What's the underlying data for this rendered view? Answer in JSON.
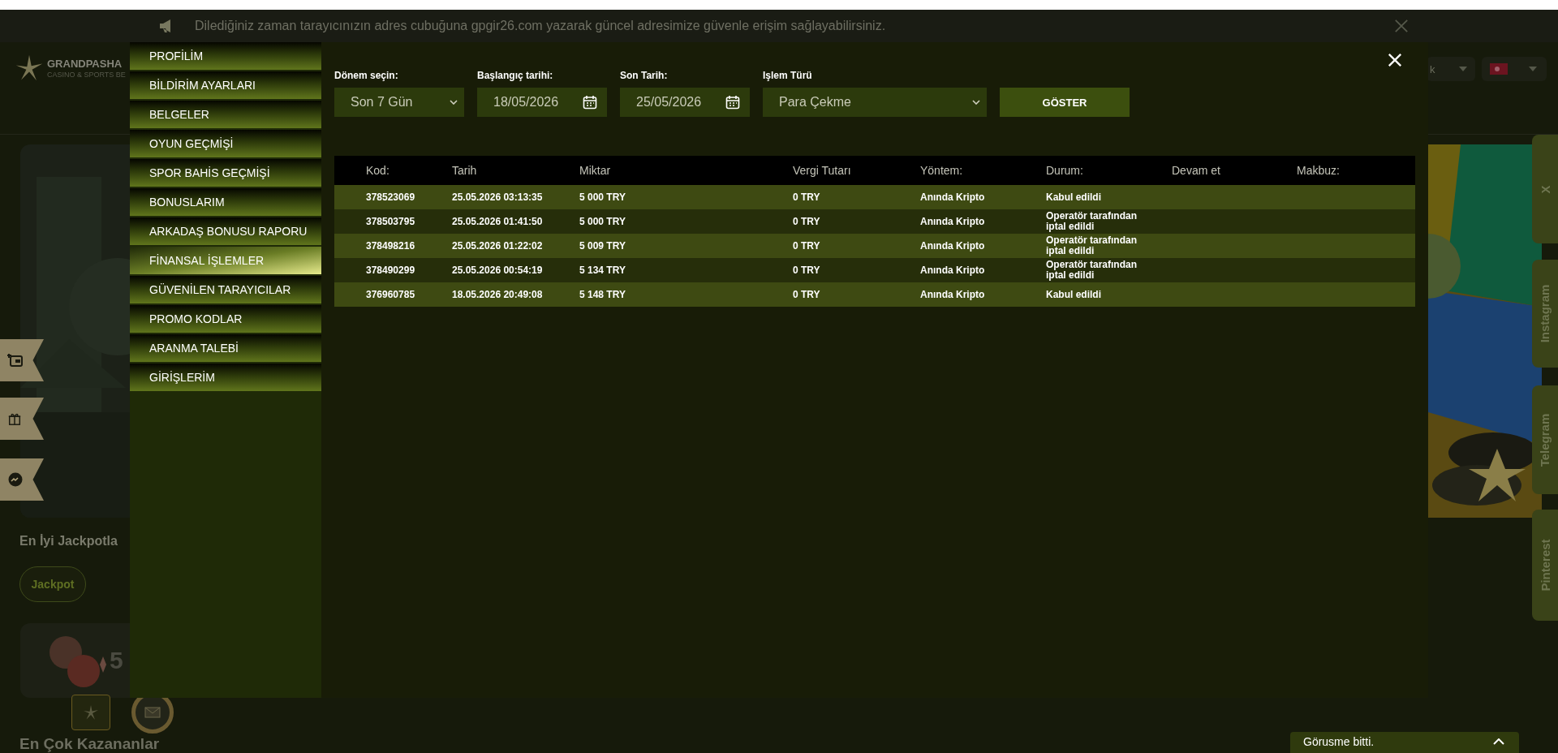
{
  "announcement": {
    "text": "Dilediğiniz zaman tarayıcınızın adres cubuğuna gpgir26.com yazarak güncel adresimize güvenle erişim sağlayabilirsiniz."
  },
  "header": {
    "logo_title": "GRANDPASHA",
    "logo_subtitle": "CASINO & SPORTS BE",
    "language": "k"
  },
  "page": {
    "jackpot_heading": "En İyi Jackpotla",
    "jackpot_chip": "Jackpot",
    "jackpot_amount": "5",
    "winners_heading": "En Çok Kazananlar"
  },
  "social_tabs": [
    "X",
    "Instagram",
    "Telegram",
    "Pinterest"
  ],
  "chat": {
    "text": "Görusme bitti."
  },
  "modal": {
    "menu": [
      {
        "label": "PROFİLİM",
        "selected": false
      },
      {
        "label": "BİLDİRİM AYARLARI",
        "selected": false
      },
      {
        "label": "BELGELER",
        "selected": false
      },
      {
        "label": "OYUN GEÇMİŞİ",
        "selected": false
      },
      {
        "label": "SPOR BAHİS GEÇMİŞİ",
        "selected": false
      },
      {
        "label": "BONUSLARIM",
        "selected": false
      },
      {
        "label": "ARKADAŞ BONUSU RAPORU",
        "selected": false
      },
      {
        "label": "FİNANSAL İŞLEMLER",
        "selected": true
      },
      {
        "label": "GÜVENİLEN TARAYICILAR",
        "selected": false
      },
      {
        "label": "PROMO KODLAR",
        "selected": false
      },
      {
        "label": "ARANMA TALEBİ",
        "selected": false
      },
      {
        "label": "GİRİŞLERİM",
        "selected": false
      }
    ],
    "filters": [
      {
        "kind": "select",
        "label": "Dönem seçin:",
        "value": "Son 7 Gün"
      },
      {
        "kind": "date",
        "label": "Başlangıç tarihi:",
        "value": "18/05/2026"
      },
      {
        "kind": "date",
        "label": "Son Tarih:",
        "value": "25/05/2026"
      },
      {
        "kind": "select",
        "label": "Işlem Türü",
        "value": "Para Çekme"
      }
    ],
    "show_button": "GÖSTER",
    "table": {
      "columns": [
        "Kod:",
        "Tarih",
        "Miktar",
        "Vergi Tutarı",
        "Yöntem:",
        "Durum:",
        "Devam et",
        "Makbuz:"
      ],
      "rows": [
        [
          "378523069",
          "25.05.2026 03:13:35",
          "5 000 TRY",
          "0 TRY",
          "Anında Kripto",
          "Kabul edildi"
        ],
        [
          "378503795",
          "25.05.2026 01:41:50",
          "5 000 TRY",
          "0 TRY",
          "Anında Kripto",
          "Operatör tarafından iptal edildi"
        ],
        [
          "378498216",
          "25.05.2026 01:22:02",
          "5 009 TRY",
          "0 TRY",
          "Anında Kripto",
          "Operatör tarafından iptal edildi"
        ],
        [
          "378490299",
          "25.05.2026 00:54:19",
          "5 134 TRY",
          "0 TRY",
          "Anında Kripto",
          "Operatör tarafından iptal edildi"
        ],
        [
          "376960785",
          "18.05.2026 20:49:08",
          "5 148 TRY",
          "0 TRY",
          "Anında Kripto",
          "Kabul edildi"
        ]
      ]
    }
  }
}
